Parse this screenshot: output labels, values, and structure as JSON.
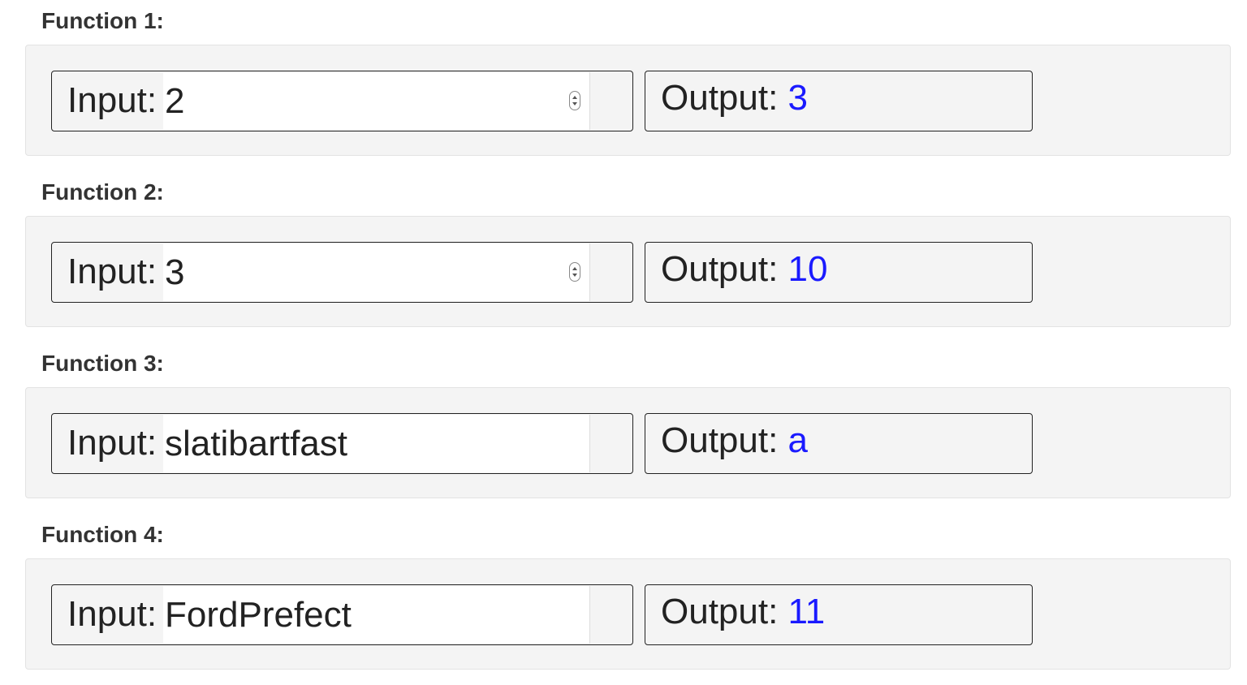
{
  "functions": [
    {
      "title": "Function 1:",
      "input_label": "Input:",
      "input_value": "2",
      "input_type": "number",
      "output_label": "Output:",
      "output_value": "3"
    },
    {
      "title": "Function 2:",
      "input_label": "Input:",
      "input_value": "3",
      "input_type": "number",
      "output_label": "Output:",
      "output_value": "10"
    },
    {
      "title": "Function 3:",
      "input_label": "Input:",
      "input_value": "slatibartfast",
      "input_type": "text",
      "output_label": "Output:",
      "output_value": "a"
    },
    {
      "title": "Function 4:",
      "input_label": "Input:",
      "input_value": "FordPrefect",
      "input_type": "text",
      "output_label": "Output:",
      "output_value": "11"
    }
  ],
  "colors": {
    "panel_background": "#f4f4f4",
    "output_value": "#1a1aff",
    "text": "#222222"
  },
  "icons": {
    "number_spinner": "spinner-icon"
  }
}
